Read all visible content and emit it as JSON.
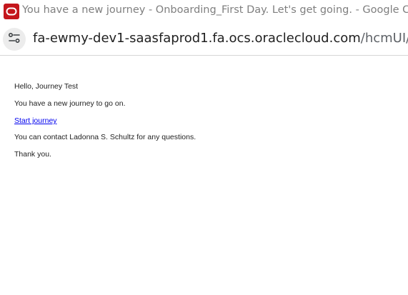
{
  "window": {
    "title": "You have a new journey - Onboarding_First Day. Let's get going. - Google Chrome",
    "app_icon": "oracle-icon"
  },
  "address_bar": {
    "site_info_icon": "tune-icon",
    "url_host": "fa-ewmy-dev1-saasfaprod1.fa.ocs.oraclecloud.com",
    "url_path": "/hcmUI/faces/adf"
  },
  "message": {
    "greeting": "Hello, Journey Test",
    "intro": "You have a new journey to go on.",
    "link_label": "Start journey",
    "contact": "You can contact Ladonna S. Schultz for any questions.",
    "closing": "Thank you."
  },
  "colors": {
    "oracle_red": "#c4161c",
    "link": "#0000ee",
    "title_text": "#7f7f7f"
  }
}
